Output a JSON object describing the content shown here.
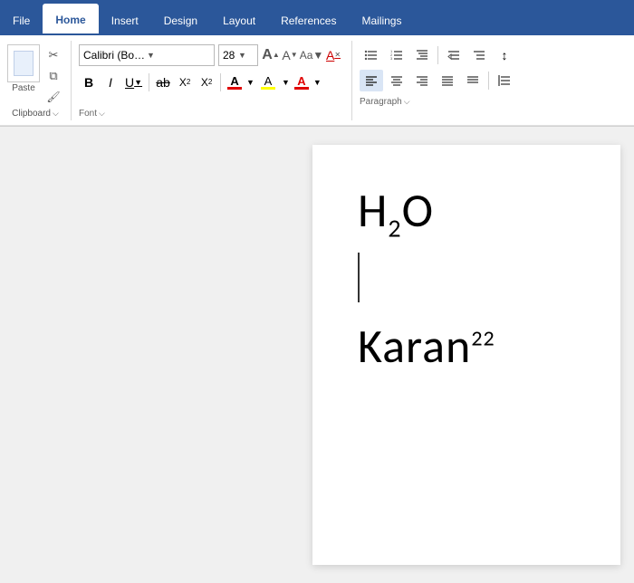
{
  "tabs": [
    {
      "id": "file",
      "label": "File",
      "active": false
    },
    {
      "id": "home",
      "label": "Home",
      "active": true
    },
    {
      "id": "insert",
      "label": "Insert",
      "active": false
    },
    {
      "id": "design",
      "label": "Design",
      "active": false
    },
    {
      "id": "layout",
      "label": "Layout",
      "active": false
    },
    {
      "id": "references",
      "label": "References",
      "active": false
    },
    {
      "id": "mailings",
      "label": "Mailings",
      "active": false
    }
  ],
  "toolbar": {
    "clipboard": {
      "paste_label": "Paste",
      "cut_label": "✂",
      "copy_label": "⧉",
      "format_painter_label": "🖌",
      "section_label": "Clipboard",
      "expand_icon": "⌵"
    },
    "font": {
      "font_name": "Calibri (Body)",
      "font_size": "28",
      "grow_icon": "A",
      "shrink_icon": "A",
      "change_case_label": "Aa",
      "clear_format_label": "A",
      "bold_label": "B",
      "italic_label": "I",
      "underline_label": "U",
      "strikethrough_label": "ab",
      "subscript_label": "X₂",
      "superscript_label": "X²",
      "font_color_label": "A",
      "font_color": "#e00000",
      "highlight_label": "A",
      "highlight_color": "#ffff00",
      "section_label": "Font",
      "expand_icon": "⌵"
    },
    "paragraph": {
      "bullets_label": "≡",
      "numbering_label": "≡",
      "multilevel_label": "≡",
      "decrease_indent_label": "⇤",
      "increase_indent_label": "⇥",
      "align_left_label": "≡",
      "align_center_label": "≡",
      "align_right_label": "≡",
      "justify_label": "≡",
      "line_spacing_label": "↕",
      "section_label": "Paragraph",
      "expand_icon": "⌵"
    }
  },
  "document": {
    "h2o": "H₂O",
    "karan": "Karan",
    "superscript": "22"
  }
}
